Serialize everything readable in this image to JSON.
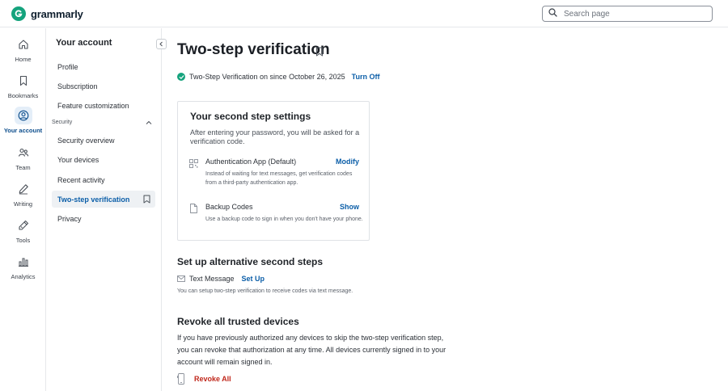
{
  "app": {
    "name": "grammarly",
    "brand_color": "#15a37d",
    "accent_color": "#0b5ea8",
    "danger_color": "#c0281c"
  },
  "search": {
    "placeholder": "Search page",
    "value": "",
    "icon": "search-icon"
  },
  "rail": {
    "items": [
      {
        "label": "Home",
        "icon": "home-icon",
        "active": false
      },
      {
        "label": "Bookmarks",
        "icon": "bookmark-icon",
        "active": false
      },
      {
        "label": "Your account",
        "icon": "user-circle-icon",
        "active": true
      },
      {
        "label": "Team",
        "icon": "team-icon",
        "active": false
      },
      {
        "label": "Writing",
        "icon": "pen-icon",
        "active": false
      },
      {
        "label": "Tools",
        "icon": "tools-icon",
        "active": false
      },
      {
        "label": "Analytics",
        "icon": "analytics-icon",
        "active": false
      }
    ]
  },
  "sidebar": {
    "title": "Your account",
    "items": [
      {
        "label": "Profile"
      },
      {
        "label": "Subscription"
      },
      {
        "label": "Feature customization"
      }
    ],
    "section_label": "Security",
    "security_items": [
      {
        "label": "Security overview"
      },
      {
        "label": "Your devices"
      },
      {
        "label": "Recent activity"
      },
      {
        "label": "Two-step verification",
        "active": true
      },
      {
        "label": "Privacy"
      }
    ]
  },
  "main": {
    "title": "Two-step verification",
    "status": {
      "text": "Two-Step Verification on since October 26, 2025",
      "action": "Turn Off"
    },
    "second_step": {
      "title": "Your second step settings",
      "description": "After entering your password, you will be asked for a verification code.",
      "methods": [
        {
          "name": "Authentication App (Default)",
          "action": "Modify",
          "description": "Instead of waiting for text messages, get verification codes from a third-party authentication app.",
          "icon": "qr-code-icon"
        },
        {
          "name": "Backup Codes",
          "action": "Show",
          "description": "Use a backup code to sign in when you don't have your phone.",
          "icon": "document-icon"
        }
      ]
    },
    "alternative": {
      "title": "Set up alternative second steps",
      "method_name": "Text Message",
      "action": "Set Up",
      "description": "You can setup two-step verification to receive codes via text message."
    },
    "revoke": {
      "title": "Revoke all trusted devices",
      "description": "If you have previously authorized any devices to skip the two-step verification step, you can revoke that authorization at any time. All devices currently signed in to your account will remain signed in.",
      "action": "Revoke All"
    }
  }
}
